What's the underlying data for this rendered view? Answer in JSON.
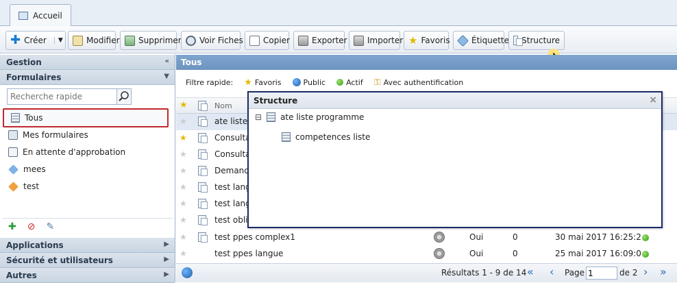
{
  "tabs": [
    {
      "label": "Accueil"
    }
  ],
  "toolbar": {
    "create": "Créer",
    "modify": "Modifier",
    "delete": "Supprimer",
    "view_forms": "Voir Fiches",
    "copy": "Copier",
    "export": "Exporter",
    "import": "Importer",
    "favorites": "Favoris",
    "tag": "Étiquette",
    "structure": "Structure"
  },
  "left_panel": {
    "gestion": "Gestion",
    "formulaires": "Formulaires",
    "search_placeholder": "Recherche rapide",
    "items": [
      {
        "label": "Tous"
      },
      {
        "label": "Mes formulaires"
      },
      {
        "label": "En attente d'approbation"
      },
      {
        "label": "mees"
      },
      {
        "label": "test"
      }
    ],
    "sections": [
      "Applications",
      "Sécurité et utilisateurs",
      "Autres"
    ]
  },
  "main": {
    "title": "Tous",
    "filter_label": "Filtre rapide:",
    "filters": [
      "Favoris",
      "Public",
      "Actif",
      "Avec authentification"
    ],
    "column_name": "Nom",
    "rows": [
      {
        "name": "ate liste",
        "starred": false
      },
      {
        "name": "Consulta",
        "starred": true
      },
      {
        "name": "Consulta",
        "starred": false
      },
      {
        "name": "Demand",
        "starred": false
      },
      {
        "name": "test lang",
        "starred": false
      },
      {
        "name": "test lang",
        "starred": false
      },
      {
        "name": "test obli",
        "starred": false
      },
      {
        "name": "test ppes complex1",
        "starred": false,
        "public": "Oui",
        "count": "0",
        "date": "30 mai 2017 16:25:2"
      },
      {
        "name": "test ppes langue",
        "starred": false,
        "public": "Oui",
        "count": "0",
        "date": "25 mai 2017 16:09:0"
      }
    ],
    "pager": {
      "results": "Résultats 1 - 9 de 14",
      "page_label": "Page",
      "page_value": "1",
      "of_label": "de 2"
    }
  },
  "structure_modal": {
    "title": "Structure",
    "close": "×",
    "tree": [
      {
        "label": "ate liste programme",
        "toggle": "⊟"
      },
      {
        "label": "competences liste"
      }
    ]
  }
}
